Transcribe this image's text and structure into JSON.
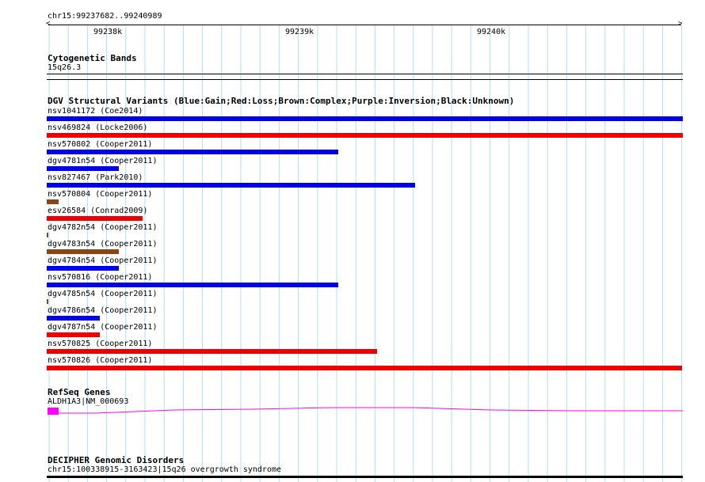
{
  "ruler": {
    "coordinates": "chr15:99237682..99240989",
    "ticks": [
      "99238k",
      "99239k",
      "99240k"
    ]
  },
  "cytoband": {
    "title": "Cytogenetic Bands",
    "band": "15q26.3"
  },
  "dgv": {
    "title": "DGV Structural Variants (Blue:Gain;Red:Loss;Brown:Complex;Purple:Inversion;Black:Unknown)",
    "colors": {
      "gain": "#0000ee",
      "loss": "#ee0000",
      "complex": "#8b4513"
    },
    "variants": [
      {
        "label": "nsv1041172 (Coe2014)",
        "type": "gain"
      },
      {
        "label": "nsv469824 (Locke2006)",
        "type": "loss"
      },
      {
        "label": "nsv570802 (Cooper2011)",
        "type": "gain"
      },
      {
        "label": "dgv4781n54 (Cooper2011)",
        "type": "gain"
      },
      {
        "label": "nsv827467 (Park2010)",
        "type": "gain"
      },
      {
        "label": "nsv570804 (Cooper2011)",
        "type": "complex"
      },
      {
        "label": "esv26584 (Conrad2009)",
        "type": "loss"
      },
      {
        "label": "dgv4782n54 (Cooper2011)",
        "type": "complex"
      },
      {
        "label": "dgv4783n54 (Cooper2011)",
        "type": "complex"
      },
      {
        "label": "dgv4784n54 (Cooper2011)",
        "type": "gain"
      },
      {
        "label": "nsv570816 (Cooper2011)",
        "type": "gain"
      },
      {
        "label": "dgv4785n54 (Cooper2011)",
        "type": "complex"
      },
      {
        "label": "dgv4786n54 (Cooper2011)",
        "type": "gain"
      },
      {
        "label": "dgv4787n54 (Cooper2011)",
        "type": "loss"
      },
      {
        "label": "nsv570825 (Cooper2011)",
        "type": "loss"
      },
      {
        "label": "nsv570826 (Cooper2011)",
        "type": "loss"
      }
    ]
  },
  "refseq": {
    "title": "RefSeq Genes",
    "gene": "ALDH1A3|NM_000693",
    "color": "#ff00ff"
  },
  "decipher": {
    "title": "DECIPHER Genomic Disorders",
    "item": "chr15:100338915-3163423|15q26 overgrowth syndrome"
  }
}
